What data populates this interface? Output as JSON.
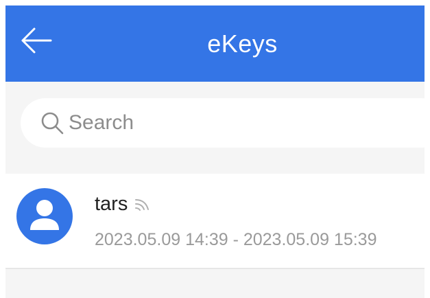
{
  "colors": {
    "header_bg": "#3475e6",
    "avatar_bg": "#3475e6",
    "page_bg": "#f5f5f5"
  },
  "header": {
    "back_icon": "arrow-left-icon",
    "title": "eKeys"
  },
  "search": {
    "icon": "search-icon",
    "placeholder": "Search",
    "value": ""
  },
  "ekeys": [
    {
      "name": "tars",
      "status_icon": "signal-icon",
      "validity": "2023.05.09 14:39 - 2023.05.09 15:39"
    }
  ]
}
